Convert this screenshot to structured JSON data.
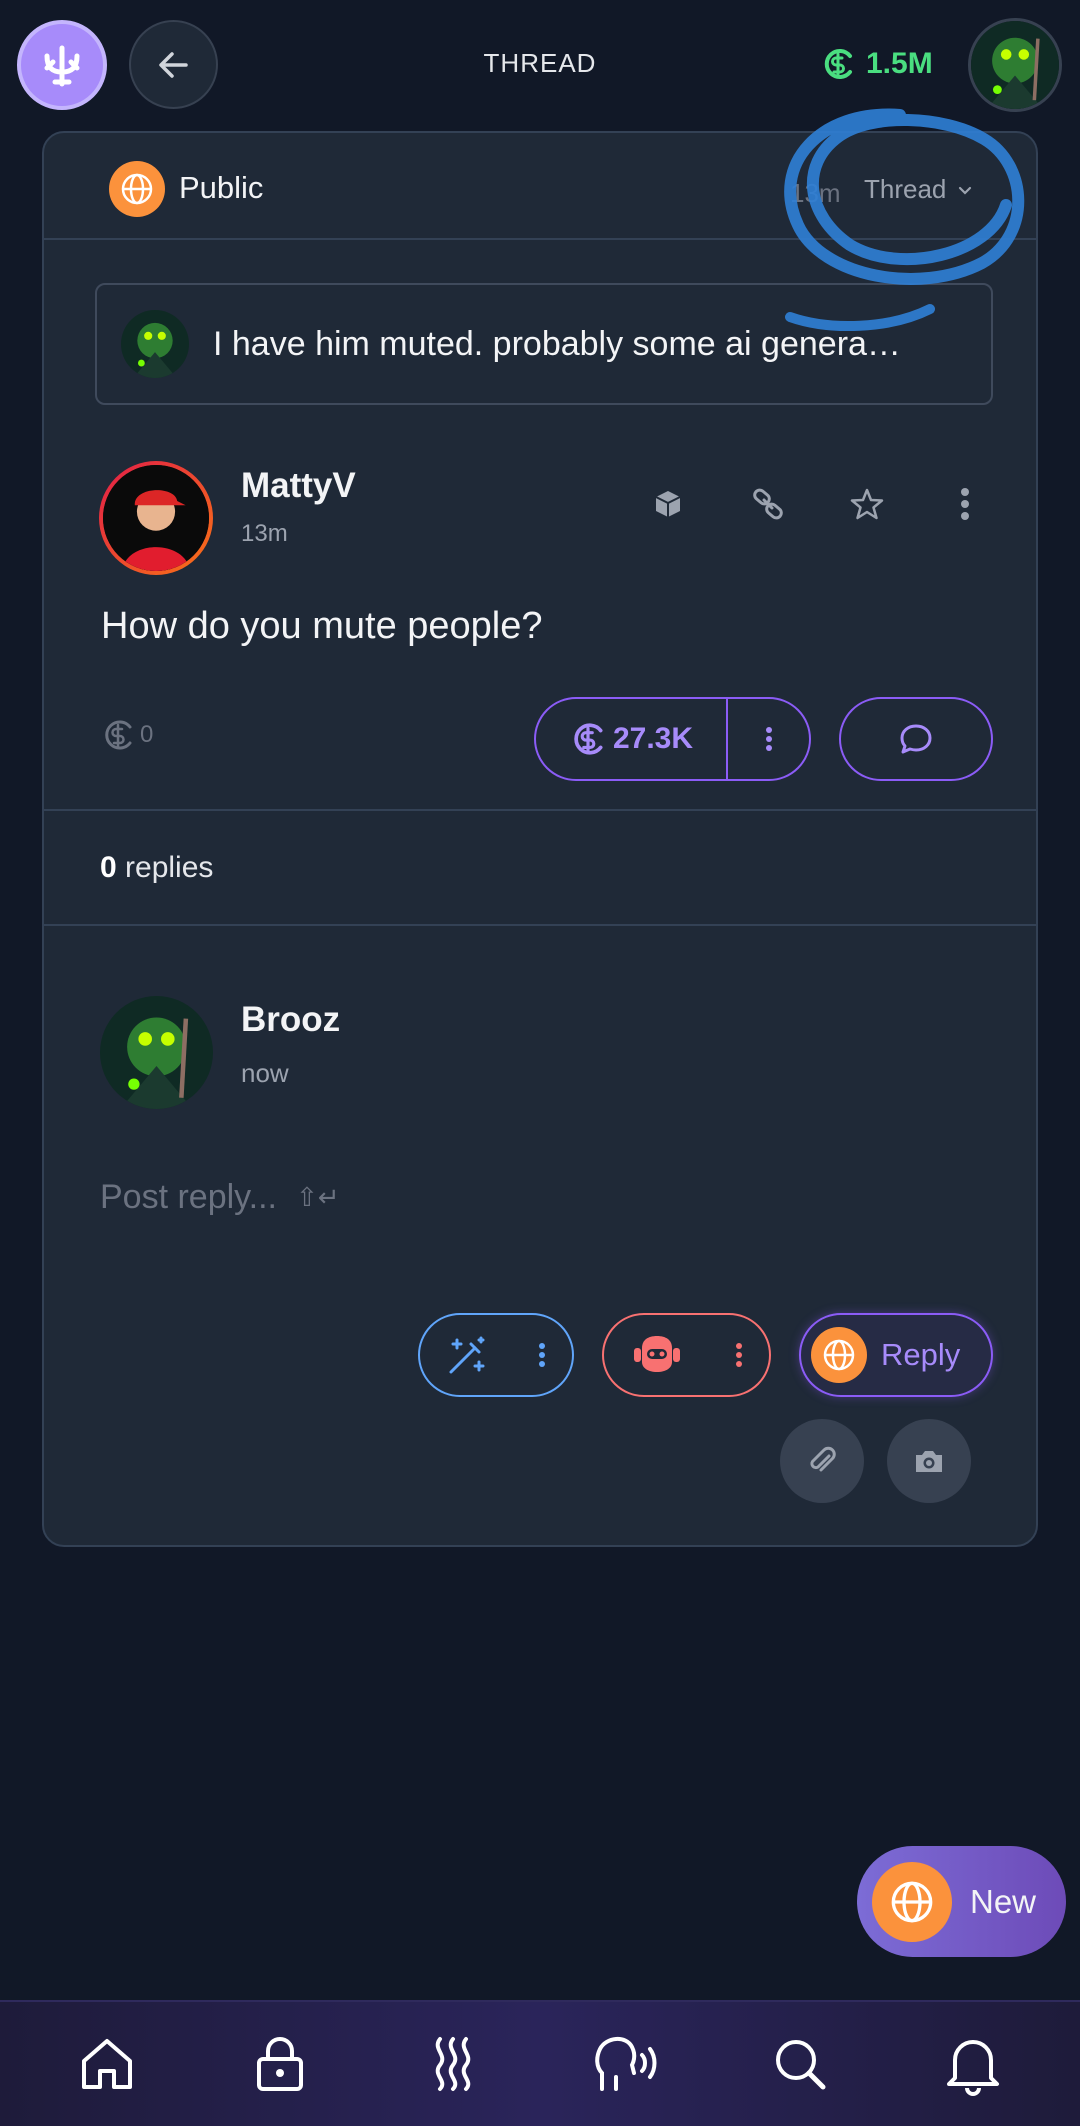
{
  "header": {
    "title": "THREAD",
    "balance": "1.5M",
    "logo_icon": "trident-logo-icon",
    "back_icon": "arrow-left-icon"
  },
  "card": {
    "audience": "Public",
    "meta_time": "13m",
    "thread_select": "Thread",
    "quote_text": "I have him muted. probably some ai genera…",
    "post": {
      "author": "MattyV",
      "time": "13m",
      "body": "How do you mute people?",
      "tip_count": "0",
      "zap_amount": "27.3K"
    },
    "replies": {
      "count": "0",
      "label": "replies"
    },
    "composer": {
      "author": "Brooz",
      "time": "now",
      "placeholder": "Post reply...",
      "shortcut": "⇧↵",
      "reply_label": "Reply"
    }
  },
  "fab": {
    "label": "New"
  },
  "nav": [
    "home-icon",
    "lock-icon",
    "waves-icon",
    "speaking-head-icon",
    "search-icon",
    "bell-icon"
  ],
  "colors": {
    "background": "#111827",
    "card": "#1f2937",
    "accent": "#8b5cf6",
    "balance": "#4ade80",
    "globe": "#fb923c",
    "magic": "#60a5fa",
    "bot": "#f87171",
    "annotation": "#2f7fd6"
  }
}
